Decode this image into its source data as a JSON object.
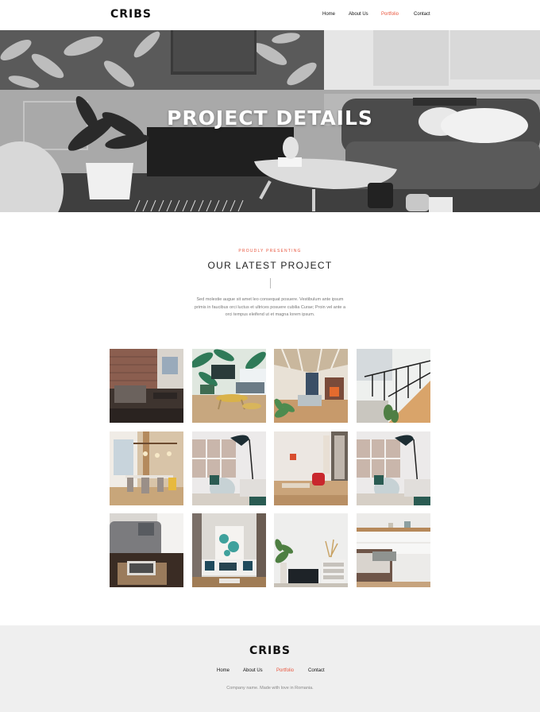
{
  "header": {
    "logo": "CRIBS",
    "nav": [
      {
        "label": "Home",
        "active": false
      },
      {
        "label": "About Us",
        "active": false
      },
      {
        "label": "Portfolio",
        "active": true
      },
      {
        "label": "Contact",
        "active": false
      }
    ]
  },
  "hero": {
    "title": "PROJECT DETAILS",
    "image": "grayscale-living-room-photo"
  },
  "intro": {
    "kicker": "PROUDLY PRESENTING",
    "title": "OUR LATEST PROJECT",
    "description": "Sed molestie augue sit amet leo consequat posuere. Vestibulum ante ipsum primis in faucibus orci luctus et ultrices posuere cubilia Curae; Proin vel ante a orci tempus eleifend ut et magna lorem ipsum."
  },
  "gallery": {
    "images": [
      "brick-wall-living-room",
      "tropical-wallpaper-living-room",
      "loft-kitchen-fireplace",
      "staircase-plants",
      "dining-room-chandelier",
      "sitting-area-floor-lamp",
      "living-room-red-chair",
      "sitting-area-floor-lamp",
      "grey-sofa-magazines",
      "teal-sofa-artwork",
      "black-sofa-plant",
      "white-bedroom-dresser"
    ]
  },
  "footer": {
    "logo": "CRIBS",
    "nav": [
      {
        "label": "Home",
        "active": false
      },
      {
        "label": "About Us",
        "active": false
      },
      {
        "label": "Portfolio",
        "active": true
      },
      {
        "label": "Contact",
        "active": false
      }
    ],
    "copyright": "Company name. Made with love in Romania."
  },
  "colors": {
    "accent": "#e8543c",
    "footer_bg": "#efefef",
    "text_dark": "#111111"
  }
}
